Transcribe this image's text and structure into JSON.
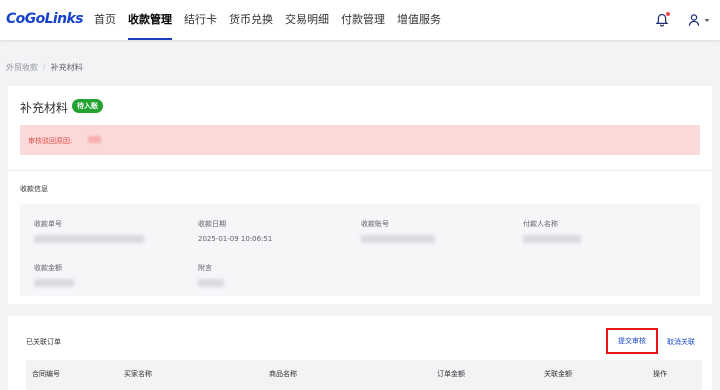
{
  "brand": {
    "logo_text": "CoGoLinks",
    "accent": "#1a3bbf"
  },
  "nav": {
    "items": [
      {
        "label": "首页"
      },
      {
        "label": "收款管理"
      },
      {
        "label": "结行卡"
      },
      {
        "label": "货币兑换"
      },
      {
        "label": "交易明细"
      },
      {
        "label": "付款管理"
      },
      {
        "label": "增值服务"
      }
    ],
    "active_index": 1,
    "icons": [
      "bell-icon",
      "user-icon",
      "chevron-down-icon"
    ]
  },
  "breadcrumb": {
    "parent": "外贸收款",
    "separator": "/",
    "current": "补充材料"
  },
  "page": {
    "title": "补充材料",
    "status_badge": "待入账",
    "status_color": "#22a22f",
    "alert_text": "审核驳回原因:",
    "alert_color": "#e0504b"
  },
  "receipt_info": {
    "section_title": "收款信息",
    "fields": [
      {
        "label": "收款单号"
      },
      {
        "label": "收款日期",
        "value": "2025-01-09 10:06:51"
      },
      {
        "label": "收款账号"
      },
      {
        "label": "付款人名称"
      },
      {
        "label": "收款金额"
      },
      {
        "label": "附言"
      }
    ]
  },
  "orders": {
    "section_title": "已关联订单",
    "submit_button": "提交审核",
    "cancel_link": "取消关联",
    "columns": [
      "合同编号",
      "买家名称",
      "商品名称",
      "订单金额",
      "关联金额",
      "操作"
    ]
  }
}
